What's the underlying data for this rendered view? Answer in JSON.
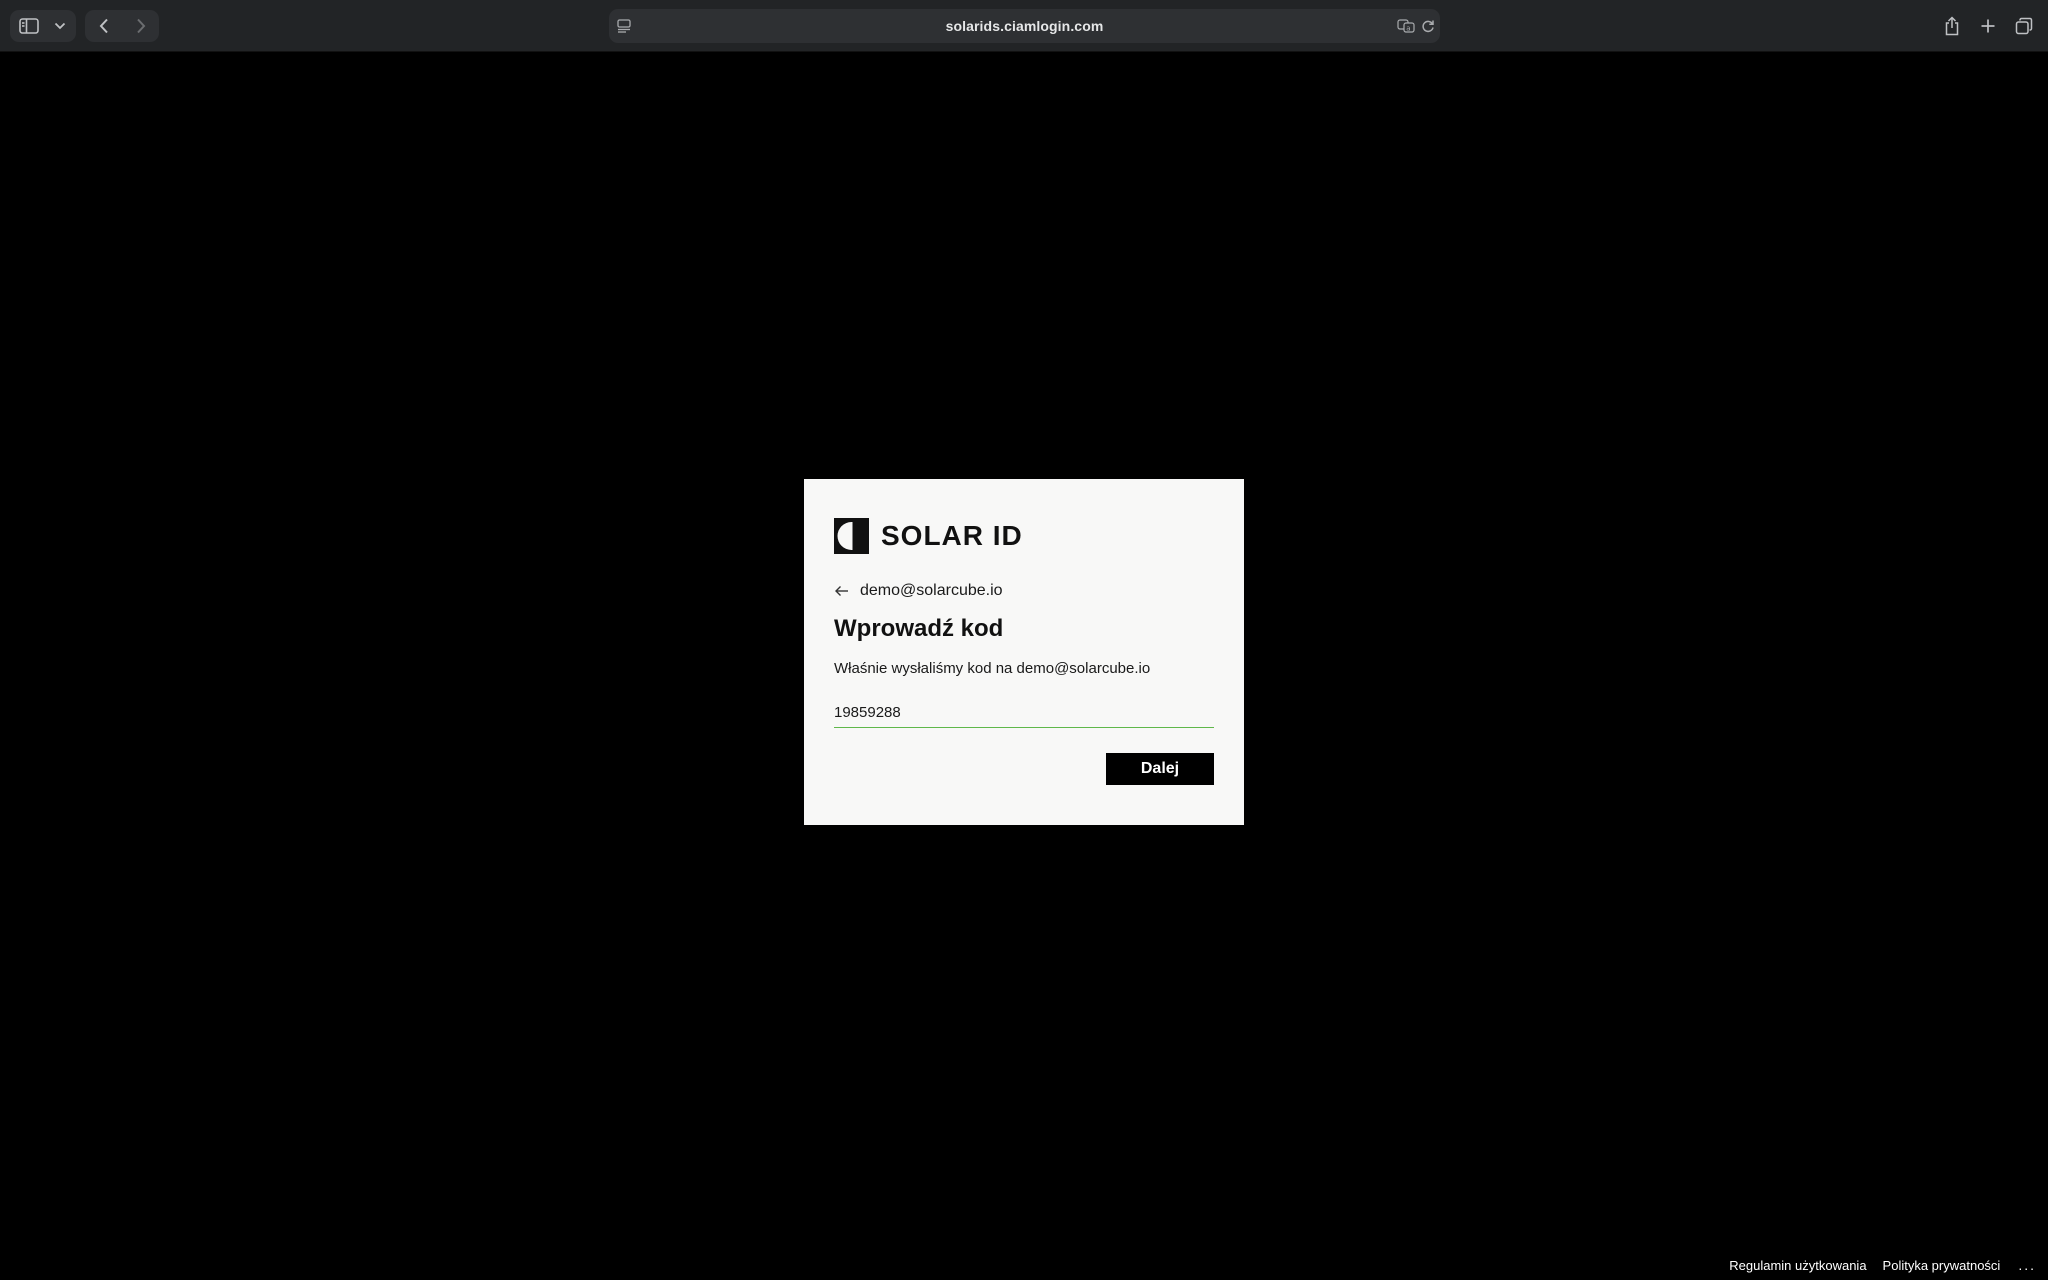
{
  "browser": {
    "url": "solarids.ciamlogin.com",
    "icons": {
      "sidebar": "sidebar-icon",
      "sidebar_menu": "chevron-down-icon",
      "back": "chevron-left-icon",
      "forward": "chevron-right-icon",
      "page_settings": "page-menu-icon",
      "translate": "translate-icon",
      "reload": "reload-icon",
      "share": "share-icon",
      "new_tab": "plus-icon",
      "tab_overview": "tabs-icon"
    }
  },
  "card": {
    "logo_text": "SOLAR ID",
    "back_email": "demo@solarcube.io",
    "heading": "Wprowadź kod",
    "description": "Właśnie wysłaliśmy kod na demo@solarcube.io",
    "code_value": "19859288",
    "submit_label": "Dalej"
  },
  "footer": {
    "terms": "Regulamin użytkowania",
    "privacy": "Polityka prywatności",
    "more": "..."
  },
  "colors": {
    "page_background": "#000000",
    "card_background": "#f8f8f7",
    "input_underline": "#5fb84a",
    "button_background": "#000000",
    "button_text": "#ffffff"
  }
}
